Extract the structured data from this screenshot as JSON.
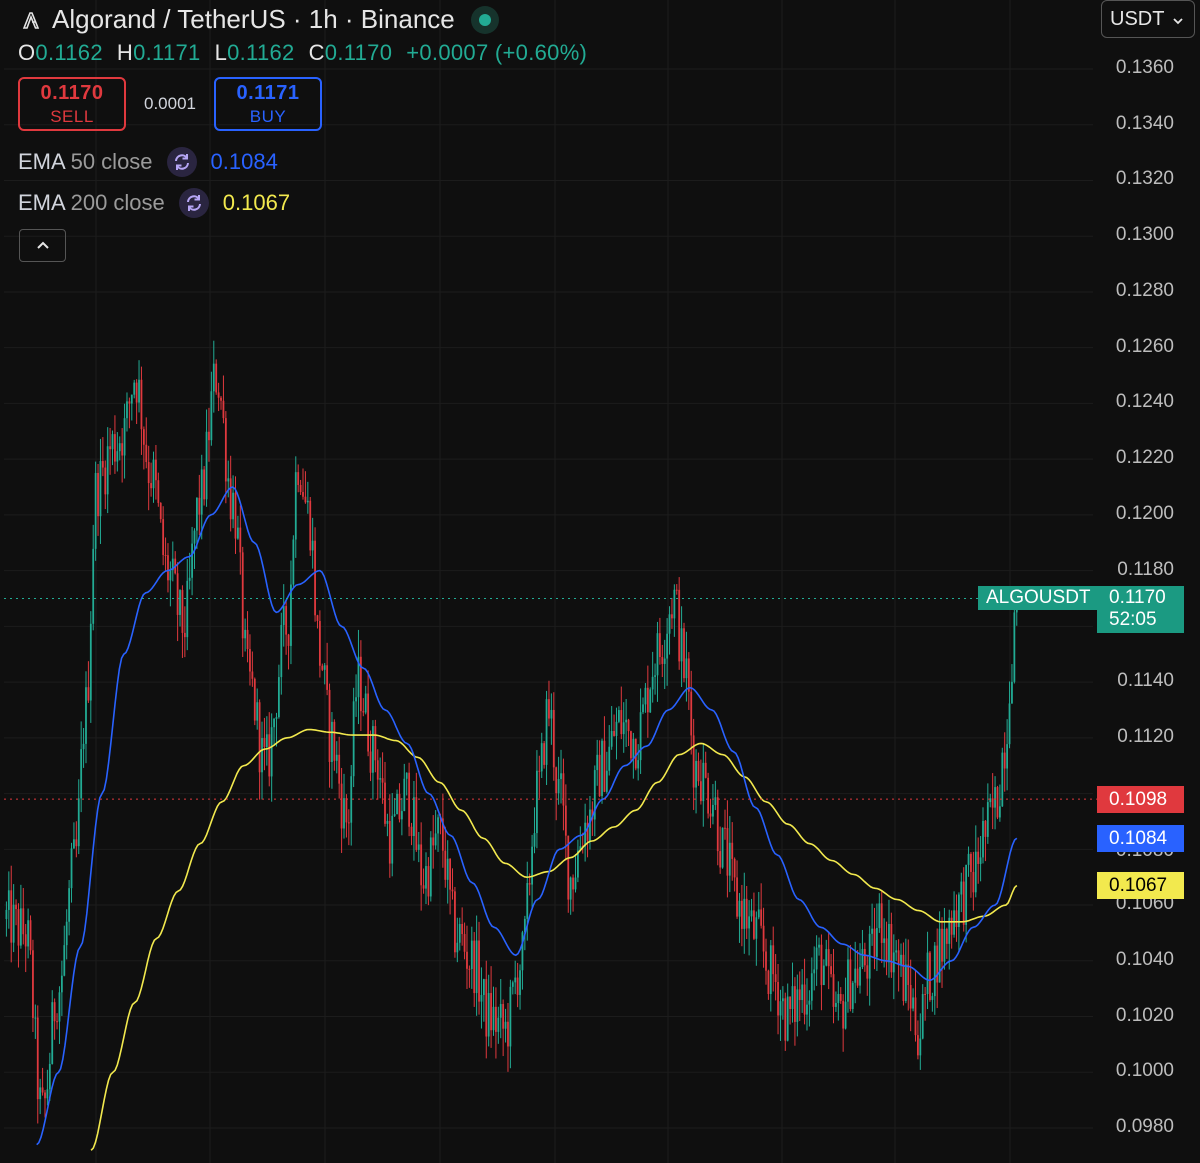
{
  "header": {
    "title": "Algorand / TetherUS · 1h · Binance",
    "logo_icon": "algorand-logo-icon",
    "live_status_color": "#22ab94"
  },
  "ohlc": {
    "o_label": "O",
    "o_value": "0.1162",
    "h_label": "H",
    "h_value": "0.1171",
    "l_label": "L",
    "l_value": "0.1162",
    "c_label": "C",
    "c_value": "0.1170",
    "change": "+0.0007 (+0.60%)"
  },
  "trade": {
    "sell_price": "0.1170",
    "sell_label": "SELL",
    "spread": "0.0001",
    "buy_price": "0.1171",
    "buy_label": "BUY"
  },
  "indicators": [
    {
      "name": "EMA",
      "params": "50 close",
      "value": "0.1084",
      "color": "#2962ff"
    },
    {
      "name": "EMA",
      "params": "200 close",
      "value": "0.1067",
      "color": "#f2e94e"
    }
  ],
  "currency": {
    "label": "USDT"
  },
  "chart_data": {
    "type": "candlestick",
    "symbol": "ALGOUSDT",
    "interval": "1h",
    "ylim": [
      0.0972,
      0.1376
    ],
    "y_ticks": [
      "0.1360",
      "0.1340",
      "0.1320",
      "0.1300",
      "0.1280",
      "0.1260",
      "0.1240",
      "0.1220",
      "0.1200",
      "0.1180",
      "0.1140",
      "0.1120",
      "0.1060",
      "0.1040",
      "0.1020",
      "0.1000",
      "0.0980"
    ],
    "up_color": "#22ab94",
    "down_color": "#e0393e",
    "close_path_anchors": [
      [
        0,
        0.1055
      ],
      [
        0.02,
        0.105
      ],
      [
        0.035,
        0.0985
      ],
      [
        0.05,
        0.103
      ],
      [
        0.065,
        0.1075
      ],
      [
        0.075,
        0.113
      ],
      [
        0.085,
        0.121
      ],
      [
        0.1,
        0.1225
      ],
      [
        0.11,
        0.123
      ],
      [
        0.12,
        0.125
      ],
      [
        0.135,
        0.1215
      ],
      [
        0.15,
        0.118
      ],
      [
        0.165,
        0.116
      ],
      [
        0.18,
        0.1205
      ],
      [
        0.195,
        0.125
      ],
      [
        0.21,
        0.1205
      ],
      [
        0.225,
        0.114
      ],
      [
        0.24,
        0.111
      ],
      [
        0.26,
        0.116
      ],
      [
        0.27,
        0.122
      ],
      [
        0.28,
        0.12
      ],
      [
        0.29,
        0.115
      ],
      [
        0.3,
        0.112
      ],
      [
        0.315,
        0.109
      ],
      [
        0.325,
        0.114
      ],
      [
        0.34,
        0.1115
      ],
      [
        0.355,
        0.1085
      ],
      [
        0.37,
        0.11
      ],
      [
        0.385,
        0.107
      ],
      [
        0.4,
        0.1085
      ],
      [
        0.415,
        0.105
      ],
      [
        0.43,
        0.104
      ],
      [
        0.445,
        0.102
      ],
      [
        0.46,
        0.1015
      ],
      [
        0.475,
        0.104
      ],
      [
        0.49,
        0.11
      ],
      [
        0.5,
        0.113
      ],
      [
        0.51,
        0.11
      ],
      [
        0.52,
        0.107
      ],
      [
        0.535,
        0.109
      ],
      [
        0.55,
        0.111
      ],
      [
        0.565,
        0.1125
      ],
      [
        0.58,
        0.112
      ],
      [
        0.6,
        0.115
      ],
      [
        0.615,
        0.117
      ],
      [
        0.625,
        0.1145
      ],
      [
        0.635,
        0.111
      ],
      [
        0.65,
        0.11
      ],
      [
        0.66,
        0.108
      ],
      [
        0.675,
        0.106
      ],
      [
        0.69,
        0.105
      ],
      [
        0.705,
        0.1035
      ],
      [
        0.72,
        0.102
      ],
      [
        0.735,
        0.103
      ],
      [
        0.75,
        0.104
      ],
      [
        0.765,
        0.102
      ],
      [
        0.78,
        0.1035
      ],
      [
        0.795,
        0.104
      ],
      [
        0.805,
        0.1055
      ],
      [
        0.815,
        0.1045
      ],
      [
        0.83,
        0.103
      ],
      [
        0.84,
        0.1015
      ],
      [
        0.85,
        0.1035
      ],
      [
        0.86,
        0.1045
      ],
      [
        0.875,
        0.106
      ],
      [
        0.89,
        0.107
      ],
      [
        0.9,
        0.1085
      ],
      [
        0.91,
        0.1095
      ],
      [
        0.92,
        0.112
      ],
      [
        0.925,
        0.115
      ],
      [
        0.93,
        0.117
      ]
    ],
    "ema50_anchors": [
      [
        0.03,
        0.0974
      ],
      [
        0.05,
        0.1
      ],
      [
        0.07,
        0.1045
      ],
      [
        0.09,
        0.11
      ],
      [
        0.11,
        0.115
      ],
      [
        0.13,
        0.1172
      ],
      [
        0.15,
        0.118
      ],
      [
        0.17,
        0.1185
      ],
      [
        0.19,
        0.12
      ],
      [
        0.21,
        0.121
      ],
      [
        0.23,
        0.119
      ],
      [
        0.25,
        0.1165
      ],
      [
        0.27,
        0.1175
      ],
      [
        0.29,
        0.118
      ],
      [
        0.31,
        0.116
      ],
      [
        0.33,
        0.1145
      ],
      [
        0.35,
        0.113
      ],
      [
        0.37,
        0.1118
      ],
      [
        0.39,
        0.11
      ],
      [
        0.41,
        0.1085
      ],
      [
        0.43,
        0.1068
      ],
      [
        0.45,
        0.1052
      ],
      [
        0.47,
        0.1042
      ],
      [
        0.49,
        0.1062
      ],
      [
        0.51,
        0.108
      ],
      [
        0.53,
        0.1085
      ],
      [
        0.55,
        0.1098
      ],
      [
        0.57,
        0.111
      ],
      [
        0.59,
        0.1117
      ],
      [
        0.61,
        0.113
      ],
      [
        0.63,
        0.1138
      ],
      [
        0.65,
        0.113
      ],
      [
        0.67,
        0.1115
      ],
      [
        0.69,
        0.1095
      ],
      [
        0.71,
        0.1078
      ],
      [
        0.73,
        0.1062
      ],
      [
        0.75,
        0.1052
      ],
      [
        0.77,
        0.1046
      ],
      [
        0.79,
        0.1042
      ],
      [
        0.81,
        0.104
      ],
      [
        0.83,
        0.1038
      ],
      [
        0.85,
        0.1033
      ],
      [
        0.87,
        0.104
      ],
      [
        0.89,
        0.1052
      ],
      [
        0.91,
        0.106
      ],
      [
        0.93,
        0.1084
      ]
    ],
    "ema200_anchors": [
      [
        0.08,
        0.0972
      ],
      [
        0.1,
        0.1
      ],
      [
        0.12,
        0.1025
      ],
      [
        0.14,
        0.1048
      ],
      [
        0.16,
        0.1065
      ],
      [
        0.18,
        0.1082
      ],
      [
        0.2,
        0.1097
      ],
      [
        0.22,
        0.111
      ],
      [
        0.24,
        0.1116
      ],
      [
        0.26,
        0.112
      ],
      [
        0.28,
        0.1123
      ],
      [
        0.3,
        0.1122
      ],
      [
        0.32,
        0.1121
      ],
      [
        0.34,
        0.1121
      ],
      [
        0.36,
        0.1119
      ],
      [
        0.38,
        0.1113
      ],
      [
        0.4,
        0.1104
      ],
      [
        0.42,
        0.1094
      ],
      [
        0.44,
        0.1084
      ],
      [
        0.46,
        0.1075
      ],
      [
        0.48,
        0.107
      ],
      [
        0.5,
        0.1072
      ],
      [
        0.52,
        0.1077
      ],
      [
        0.54,
        0.1083
      ],
      [
        0.56,
        0.1088
      ],
      [
        0.58,
        0.1094
      ],
      [
        0.6,
        0.1104
      ],
      [
        0.62,
        0.1114
      ],
      [
        0.64,
        0.1118
      ],
      [
        0.66,
        0.1114
      ],
      [
        0.68,
        0.1106
      ],
      [
        0.7,
        0.1097
      ],
      [
        0.72,
        0.1089
      ],
      [
        0.74,
        0.1082
      ],
      [
        0.76,
        0.1076
      ],
      [
        0.78,
        0.1071
      ],
      [
        0.8,
        0.1066
      ],
      [
        0.82,
        0.1062
      ],
      [
        0.84,
        0.1058
      ],
      [
        0.86,
        0.1054
      ],
      [
        0.88,
        0.1054
      ],
      [
        0.9,
        0.1056
      ],
      [
        0.92,
        0.106
      ],
      [
        0.93,
        0.1067
      ]
    ],
    "current_price": "0.1170",
    "countdown": "52:05",
    "symbol_tag_color": "#1b9a82",
    "sell_line": "0.1098",
    "sell_line_color": "#e0393e",
    "ema50_tag": "0.1084",
    "ema200_tag": "0.1067",
    "partial_label": "0.1080",
    "grid": true
  }
}
